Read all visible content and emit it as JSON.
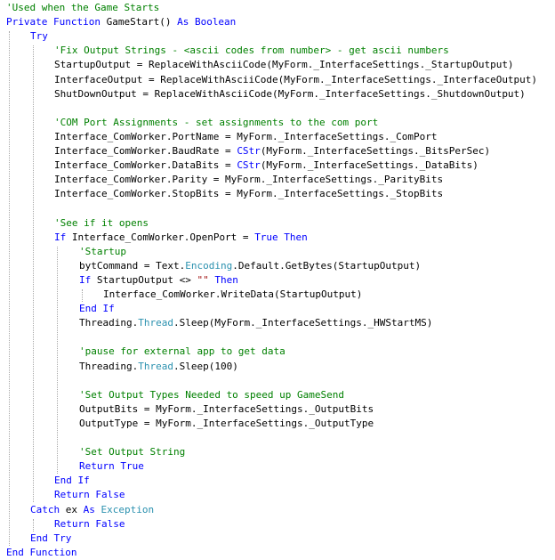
{
  "colors": {
    "keyword": "#0000ff",
    "comment": "#008000",
    "string": "#a31515",
    "type": "#2b91af",
    "plain": "#000000",
    "background": "#ffffff",
    "indent_guide": "#a8a8a8"
  },
  "code_lines": [
    {
      "indent": 0,
      "tokens": [
        {
          "t": "comment",
          "v": "'Used when the Game Starts"
        }
      ]
    },
    {
      "indent": 0,
      "tokens": [
        {
          "t": "keyword",
          "v": "Private Function "
        },
        {
          "t": "plain",
          "v": "GameStart() "
        },
        {
          "t": "keyword",
          "v": "As Boolean"
        }
      ]
    },
    {
      "indent": 1,
      "tokens": [
        {
          "t": "keyword",
          "v": "Try"
        }
      ]
    },
    {
      "indent": 2,
      "tokens": [
        {
          "t": "comment",
          "v": "'Fix Output Strings - <ascii codes from number> - get ascii numbers"
        }
      ]
    },
    {
      "indent": 2,
      "tokens": [
        {
          "t": "plain",
          "v": "StartupOutput = ReplaceWithAsciiCode(MyForm._InterfaceSettings._StartupOutput)"
        }
      ]
    },
    {
      "indent": 2,
      "tokens": [
        {
          "t": "plain",
          "v": "InterfaceOutput = ReplaceWithAsciiCode(MyForm._InterfaceSettings._InterfaceOutput)"
        }
      ]
    },
    {
      "indent": 2,
      "tokens": [
        {
          "t": "plain",
          "v": "ShutDownOutput = ReplaceWithAsciiCode(MyForm._InterfaceSettings._ShutdownOutput)"
        }
      ]
    },
    {
      "indent": 2,
      "tokens": []
    },
    {
      "indent": 2,
      "tokens": [
        {
          "t": "comment",
          "v": "'COM Port Assignments - set assignments to the com port"
        }
      ]
    },
    {
      "indent": 2,
      "tokens": [
        {
          "t": "plain",
          "v": "Interface_ComWorker.PortName = MyForm._InterfaceSettings._ComPort"
        }
      ]
    },
    {
      "indent": 2,
      "tokens": [
        {
          "t": "plain",
          "v": "Interface_ComWorker.BaudRate = "
        },
        {
          "t": "keyword",
          "v": "CStr"
        },
        {
          "t": "plain",
          "v": "(MyForm._InterfaceSettings._BitsPerSec)"
        }
      ]
    },
    {
      "indent": 2,
      "tokens": [
        {
          "t": "plain",
          "v": "Interface_ComWorker.DataBits = "
        },
        {
          "t": "keyword",
          "v": "CStr"
        },
        {
          "t": "plain",
          "v": "(MyForm._InterfaceSettings._DataBits)"
        }
      ]
    },
    {
      "indent": 2,
      "tokens": [
        {
          "t": "plain",
          "v": "Interface_ComWorker.Parity = MyForm._InterfaceSettings._ParityBits"
        }
      ]
    },
    {
      "indent": 2,
      "tokens": [
        {
          "t": "plain",
          "v": "Interface_ComWorker.StopBits = MyForm._InterfaceSettings._StopBits"
        }
      ]
    },
    {
      "indent": 2,
      "tokens": []
    },
    {
      "indent": 2,
      "tokens": [
        {
          "t": "comment",
          "v": "'See if it opens"
        }
      ]
    },
    {
      "indent": 2,
      "tokens": [
        {
          "t": "keyword",
          "v": "If "
        },
        {
          "t": "plain",
          "v": "Interface_ComWorker.OpenPort = "
        },
        {
          "t": "keyword",
          "v": "True Then"
        }
      ]
    },
    {
      "indent": 3,
      "tokens": [
        {
          "t": "comment",
          "v": "'Startup"
        }
      ]
    },
    {
      "indent": 3,
      "tokens": [
        {
          "t": "plain",
          "v": "bytCommand = Text."
        },
        {
          "t": "type",
          "v": "Encoding"
        },
        {
          "t": "plain",
          "v": ".Default.GetBytes(StartupOutput)"
        }
      ]
    },
    {
      "indent": 3,
      "tokens": [
        {
          "t": "keyword",
          "v": "If "
        },
        {
          "t": "plain",
          "v": "StartupOutput <> "
        },
        {
          "t": "string",
          "v": "\"\""
        },
        {
          "t": "keyword",
          "v": " Then"
        }
      ]
    },
    {
      "indent": 4,
      "tokens": [
        {
          "t": "plain",
          "v": "Interface_ComWorker.WriteData(StartupOutput)"
        }
      ]
    },
    {
      "indent": 3,
      "tokens": [
        {
          "t": "keyword",
          "v": "End If"
        }
      ]
    },
    {
      "indent": 3,
      "tokens": [
        {
          "t": "plain",
          "v": "Threading."
        },
        {
          "t": "type",
          "v": "Thread"
        },
        {
          "t": "plain",
          "v": ".Sleep(MyForm._InterfaceSettings._HWStartMS)"
        }
      ]
    },
    {
      "indent": 3,
      "tokens": []
    },
    {
      "indent": 3,
      "tokens": [
        {
          "t": "comment",
          "v": "'pause for external app to get data"
        }
      ]
    },
    {
      "indent": 3,
      "tokens": [
        {
          "t": "plain",
          "v": "Threading."
        },
        {
          "t": "type",
          "v": "Thread"
        },
        {
          "t": "plain",
          "v": ".Sleep(100)"
        }
      ]
    },
    {
      "indent": 3,
      "tokens": []
    },
    {
      "indent": 3,
      "tokens": [
        {
          "t": "comment",
          "v": "'Set Output Types Needed to speed up GameSend"
        }
      ]
    },
    {
      "indent": 3,
      "tokens": [
        {
          "t": "plain",
          "v": "OutputBits = MyForm._InterfaceSettings._OutputBits"
        }
      ]
    },
    {
      "indent": 3,
      "tokens": [
        {
          "t": "plain",
          "v": "OutputType = MyForm._InterfaceSettings._OutputType"
        }
      ]
    },
    {
      "indent": 3,
      "tokens": []
    },
    {
      "indent": 3,
      "tokens": [
        {
          "t": "comment",
          "v": "'Set Output String"
        }
      ]
    },
    {
      "indent": 3,
      "tokens": [
        {
          "t": "keyword",
          "v": "Return True"
        }
      ]
    },
    {
      "indent": 2,
      "tokens": [
        {
          "t": "keyword",
          "v": "End If"
        }
      ]
    },
    {
      "indent": 2,
      "tokens": [
        {
          "t": "keyword",
          "v": "Return False"
        }
      ]
    },
    {
      "indent": 1,
      "tokens": [
        {
          "t": "keyword",
          "v": "Catch "
        },
        {
          "t": "plain",
          "v": "ex "
        },
        {
          "t": "keyword",
          "v": "As "
        },
        {
          "t": "type",
          "v": "Exception"
        }
      ]
    },
    {
      "indent": 2,
      "tokens": [
        {
          "t": "keyword",
          "v": "Return False"
        }
      ]
    },
    {
      "indent": 1,
      "tokens": [
        {
          "t": "keyword",
          "v": "End Try"
        }
      ]
    },
    {
      "indent": 0,
      "tokens": [
        {
          "t": "keyword",
          "v": "End Function"
        }
      ]
    }
  ]
}
